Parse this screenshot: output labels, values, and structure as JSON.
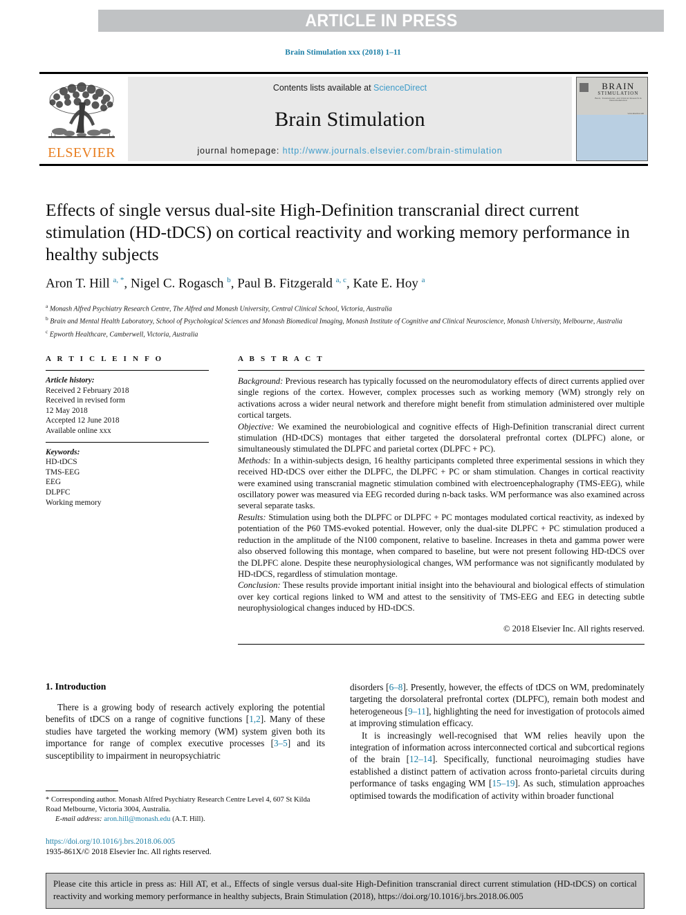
{
  "banner": {
    "text": "ARTICLE IN PRESS",
    "bg_color": "#c0c2c4",
    "text_color": "#ffffff"
  },
  "running_head": "Brain Stimulation xxx (2018) 1–11",
  "masthead": {
    "contents_prefix": "Contents lists available at ",
    "contents_link": "ScienceDirect",
    "journal_name": "Brain Stimulation",
    "homepage_prefix": "journal homepage: ",
    "homepage_link": "http://www.journals.elsevier.com/brain-stimulation",
    "publisher": "ELSEVIER",
    "publisher_color": "#e87d1e",
    "link_color": "#3d9bc9",
    "cover": {
      "title": "BRAIN",
      "subtitle": "STIMULATION",
      "tagline": "Basic, Translational, and Clinical Research in Neuromodulation",
      "corner_note": "www.elsevier.com",
      "band_color": "#b9cfe2"
    }
  },
  "article": {
    "title": "Effects of single versus dual-site High-Definition transcranial direct current stimulation (HD-tDCS) on cortical reactivity and working memory performance in healthy subjects",
    "authors_html": "Aron T. Hill <sup>a, *</sup>, Nigel C. Rogasch <sup>b</sup>, Paul B. Fitzgerald <sup>a, c</sup>, Kate E. Hoy <sup>a</sup>",
    "affiliations": [
      {
        "marker": "a",
        "text": "Monash Alfred Psychiatry Research Centre, The Alfred and Monash University, Central Clinical School, Victoria, Australia"
      },
      {
        "marker": "b",
        "text": "Brain and Mental Health Laboratory, School of Psychological Sciences and Monash Biomedical Imaging, Monash Institute of Cognitive and Clinical Neuroscience, Monash University, Melbourne, Australia"
      },
      {
        "marker": "c",
        "text": "Epworth Healthcare, Camberwell, Victoria, Australia"
      }
    ]
  },
  "article_info": {
    "heading": "A R T I C L E   I N F O",
    "history_label": "Article history:",
    "history": [
      "Received 2 February 2018",
      "Received in revised form",
      "12 May 2018",
      "Accepted 12 June 2018",
      "Available online xxx"
    ],
    "keywords_label": "Keywords:",
    "keywords": [
      "HD-tDCS",
      "TMS-EEG",
      "EEG",
      "DLPFC",
      "Working memory"
    ]
  },
  "abstract": {
    "heading": "A B S T R A C T",
    "sections": [
      {
        "label": "Background:",
        "text": " Previous research has typically focussed on the neuromodulatory effects of direct currents applied over single regions of the cortex. However, complex processes such as working memory (WM) strongly rely on activations across a wider neural network and therefore might benefit from stimulation administered over multiple cortical targets."
      },
      {
        "label": "Objective:",
        "text": " We examined the neurobiological and cognitive effects of High-Definition transcranial direct current stimulation (HD-tDCS) montages that either targeted the dorsolateral prefrontal cortex (DLPFC) alone, or simultaneously stimulated the DLPFC and parietal cortex (DLPFC + PC)."
      },
      {
        "label": "Methods:",
        "text": " In a within-subjects design, 16 healthy participants completed three experimental sessions in which they received HD-tDCS over either the DLPFC, the DLPFC + PC or sham stimulation. Changes in cortical reactivity were examined using transcranial magnetic stimulation combined with electroencephalography (TMS-EEG), while oscillatory power was measured via EEG recorded during n-back tasks. WM performance was also examined across several separate tasks."
      },
      {
        "label": "Results:",
        "text": " Stimulation using both the DLPFC or DLPFC + PC montages modulated cortical reactivity, as indexed by potentiation of the P60 TMS-evoked potential. However, only the dual-site DLPFC + PC stimulation produced a reduction in the amplitude of the N100 component, relative to baseline. Increases in theta and gamma power were also observed following this montage, when compared to baseline, but were not present following HD-tDCS over the DLPFC alone. Despite these neurophysiological changes, WM performance was not significantly modulated by HD-tDCS, regardless of stimulation montage."
      },
      {
        "label": "Conclusion:",
        "text": " These results provide important initial insight into the behavioural and biological effects of stimulation over key cortical regions linked to WM and attest to the sensitivity of TMS-EEG and EEG in detecting subtle neurophysiological changes induced by HD-tDCS."
      }
    ],
    "copyright": "© 2018 Elsevier Inc. All rights reserved."
  },
  "body": {
    "section_heading": "1. Introduction",
    "left_paragraph_parts": [
      "There is a growing body of research actively exploring the potential benefits of tDCS on a range of cognitive functions [",
      "1,2",
      "]. Many of these studies have targeted the working memory (WM) system given both its importance for range of complex executive processes [",
      "3–5",
      "] and its susceptibility to impairment in neuropsychiatric"
    ],
    "right_paragraph1_parts": [
      "disorders [",
      "6–8",
      "]. Presently, however, the effects of tDCS on WM, predominately targeting the dorsolateral prefrontal cortex (DLPFC), remain both modest and heterogeneous [",
      "9–11",
      "], highlighting the need for investigation of protocols aimed at improving stimulation efficacy."
    ],
    "right_paragraph2_parts": [
      "It is increasingly well-recognised that WM relies heavily upon the integration of information across interconnected cortical and subcortical regions of the brain [",
      "12–14",
      "]. Specifically, functional neuroimaging studies have established a distinct pattern of activation across fronto-parietal circuits during performance of tasks engaging WM [",
      "15–19",
      "]. As such, stimulation approaches optimised towards the modification of activity within broader functional"
    ],
    "reference_color": "#1b7ea6"
  },
  "footnote": {
    "corresponding": "* Corresponding author. Monash Alfred Psychiatry Research Centre Level 4, 607 St Kilda Road Melbourne, Victoria 3004, Australia.",
    "email_label": "E-mail address:",
    "email": "aron.hill@monash.edu",
    "email_suffix": " (A.T. Hill)."
  },
  "doi_block": {
    "doi": "https://doi.org/10.1016/j.brs.2018.06.005",
    "issn_line": "1935-861X/© 2018 Elsevier Inc. All rights reserved."
  },
  "citation_box": {
    "text": "Please cite this article in press as: Hill AT, et al., Effects of single versus dual-site High-Definition transcranial direct current stimulation (HD-tDCS) on cortical reactivity and working memory performance in healthy subjects, Brain Stimulation (2018), https://doi.org/10.1016/j.brs.2018.06.005",
    "bg_color": "#c9c9c9"
  }
}
